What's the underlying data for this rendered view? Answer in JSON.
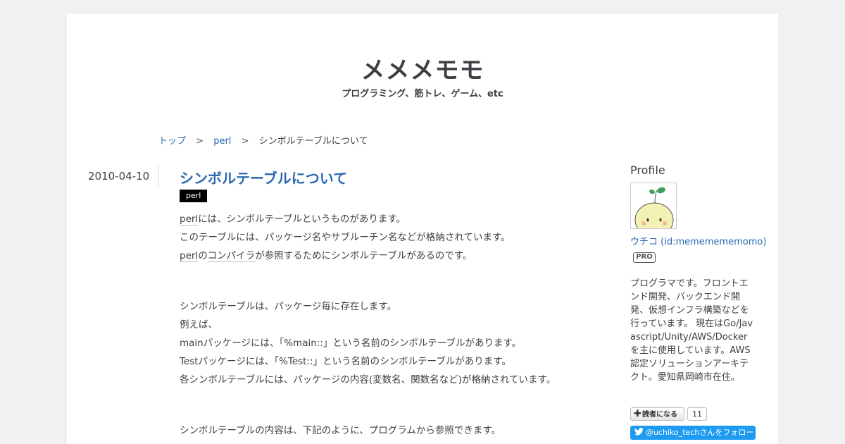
{
  "header": {
    "blog_title": "メメメモモ",
    "blog_description": "プログラミング、筋トレ、ゲーム、etc"
  },
  "breadcrumb": {
    "top": "トップ",
    "separator": ">",
    "category": "perl",
    "current": "シンボルテーブルについて"
  },
  "entry": {
    "date": "2010-04-10",
    "title": "シンボルテーブルについて",
    "category": "perl",
    "lines": [
      {
        "kw": "perl",
        "text": "には、シンボルテーブルというものがあります。"
      },
      {
        "text": "このテーブルには、パッケージ名やサブルーチン名などが格納されています。"
      },
      {
        "kw": "perl",
        "text2a": "の",
        "kw2": "コンパイラ",
        "text": "が参照するためにシンボルテーブルがあるのです。"
      },
      {
        "text": "シンボルテーブルは、パッケージ毎に存在します。"
      },
      {
        "text": "例えば、"
      },
      {
        "text": "mainパッケージには、「%main::」という名前のシンボルテーブルがあります。"
      },
      {
        "text": "Testパッケージには、「%Test::」という名前のシンボルテーブルがあります。"
      },
      {
        "text": "各シンボルテーブルには、パッケージの内容(変数名、関数名など)が格納されています。"
      },
      {
        "text": "シンボルテーブルの内容は、下記のように、プログラムから参照できます。"
      }
    ]
  },
  "sidebar": {
    "heading": "Profile",
    "author": "ウチコ (id:mememememomo)",
    "badge": "PRO",
    "bio": "プログラマです。フロントエンド開発、バックエンド開発、仮想インフラ構築などを行っています。 現在はGo/Javascript/Unity/AWS/Dockerを主に使用しています。AWS認定ソリューションアーキテクト。愛知県岡崎市在住。",
    "subscribe_label": "読者になる",
    "subscriber_count": "11",
    "twitter_follow": "@uchiko_techさんをフォロー"
  },
  "colors": {
    "link": "#2a68b2",
    "text": "#3d3f44",
    "background": "#f1f1f1",
    "twitter": "#1d9bf0"
  },
  "icons": {
    "subscribe": "plus-icon",
    "twitter": "twitter-bird-icon"
  }
}
